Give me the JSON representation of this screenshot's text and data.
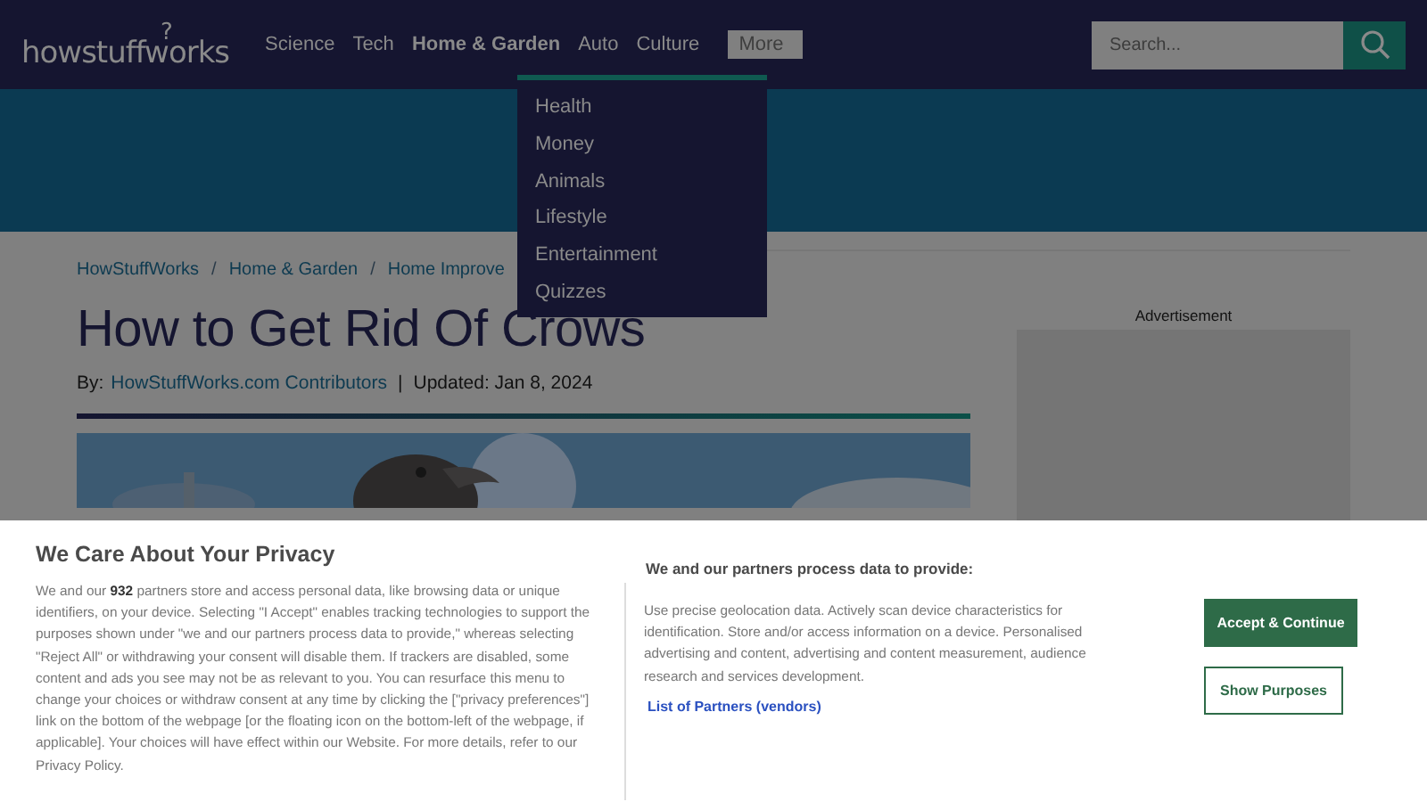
{
  "header": {
    "logo": "howstuffworks",
    "logo_mark": "?",
    "nav": [
      {
        "label": "Science",
        "selected": false
      },
      {
        "label": "Tech",
        "selected": false
      },
      {
        "label": "Home & Garden",
        "selected": true
      },
      {
        "label": "Auto",
        "selected": false
      },
      {
        "label": "Culture",
        "selected": false
      },
      {
        "label": "More",
        "selected": false,
        "expanded": true
      }
    ],
    "search": {
      "placeholder": "Search..."
    }
  },
  "dropdown": [
    "Health",
    "Money",
    "Animals",
    "Lifestyle",
    "Entertainment",
    "Quizzes"
  ],
  "breadcrumb": [
    "HowStuffWorks",
    "/",
    "Home & Garden",
    "/",
    "Home Improve"
  ],
  "article": {
    "title": "How to Get Rid Of Crows",
    "by_label": "By:",
    "author": "HowStuffWorks.com Contributors",
    "separator": "|",
    "updated": "Updated: Jan 8, 2024"
  },
  "sidebar": {
    "ad_label": "Advertisement"
  },
  "consent": {
    "title": "We Care About Your Privacy",
    "body": "We and our **932** partners store and access personal data, like browsing data or unique identifiers, on your device. Selecting \"I Accept\" enables tracking technologies to support the purposes shown under \"we and our partners process data to provide,\" whereas selecting \"Reject All\" or withdrawing your consent will disable them. If trackers are disabled, some content and ads you see may not be as relevant to you. You can resurface this menu to change your choices or withdraw consent at any time by clicking the [\"privacy preferences\"] link on the bottom of the webpage [or the floating icon on the bottom-left of the webpage, if applicable]. Your choices will have effect within our Website. For more details, refer to our Privacy Policy.",
    "purposes_title": "We and our partners process data to provide:",
    "purposes": "Use precise geolocation data. Actively scan device characteristics for identification. Store and/or access information on a device. Personalised advertising and content, advertising and content measurement, audience research and services development.",
    "partners_link": "List of Partners (vendors)",
    "buttons": [
      {
        "label": "Accept & Continue",
        "kind": "primary"
      },
      {
        "label": "Show Purposes",
        "kind": "secondary"
      }
    ]
  }
}
